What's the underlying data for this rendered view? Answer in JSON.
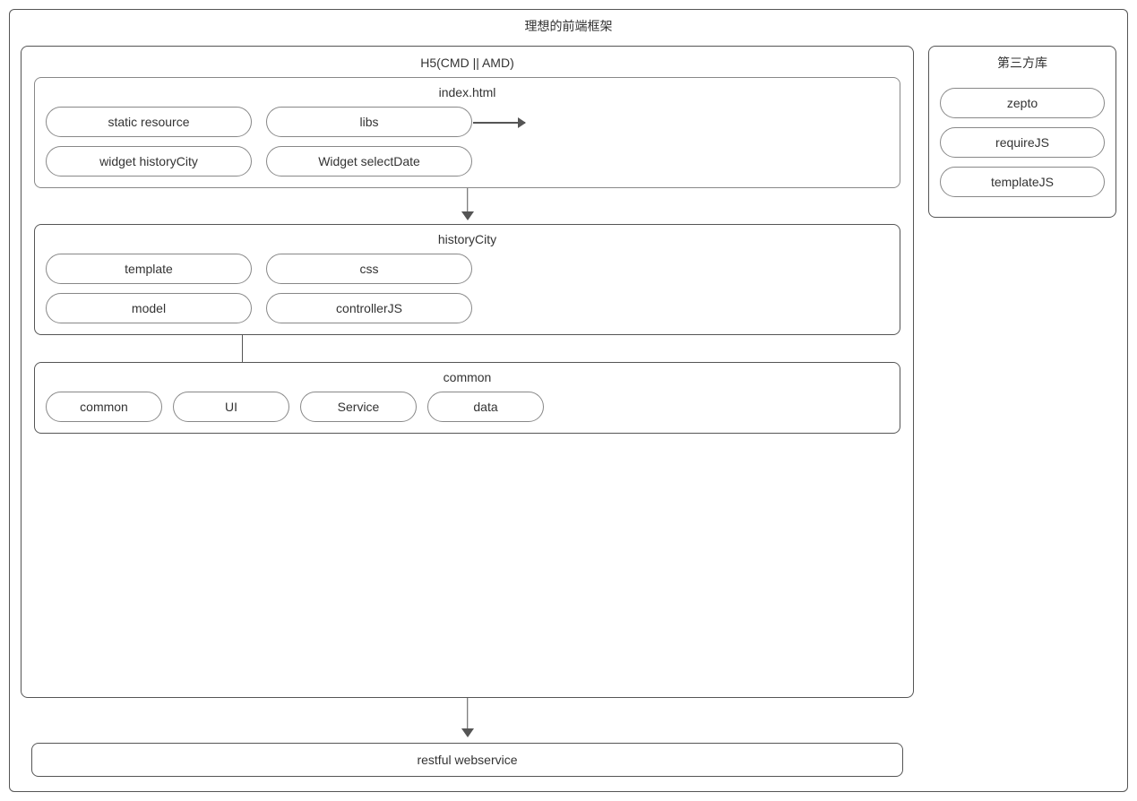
{
  "title": "理想的前端框架",
  "h5_label": "H5(CMD || AMD)",
  "third_party_label": "第三方库",
  "index_html_label": "index.html",
  "historycity_label": "historyCity",
  "common_label": "common",
  "restful_label": "restful webservice",
  "index_items": {
    "static_resource": "static resource",
    "libs": "libs",
    "widget_historycity": "widget historyCity",
    "widget_selectdate": "Widget selectDate"
  },
  "historycity_items": {
    "template": "template",
    "css": "css",
    "model": "model",
    "controllerjs": "controllerJS"
  },
  "common_items": {
    "common": "common",
    "ui": "UI",
    "service": "Service",
    "data": "data"
  },
  "third_party_items": {
    "zepto": "zepto",
    "requirejs": "requireJS",
    "templatejs": "templateJS"
  }
}
